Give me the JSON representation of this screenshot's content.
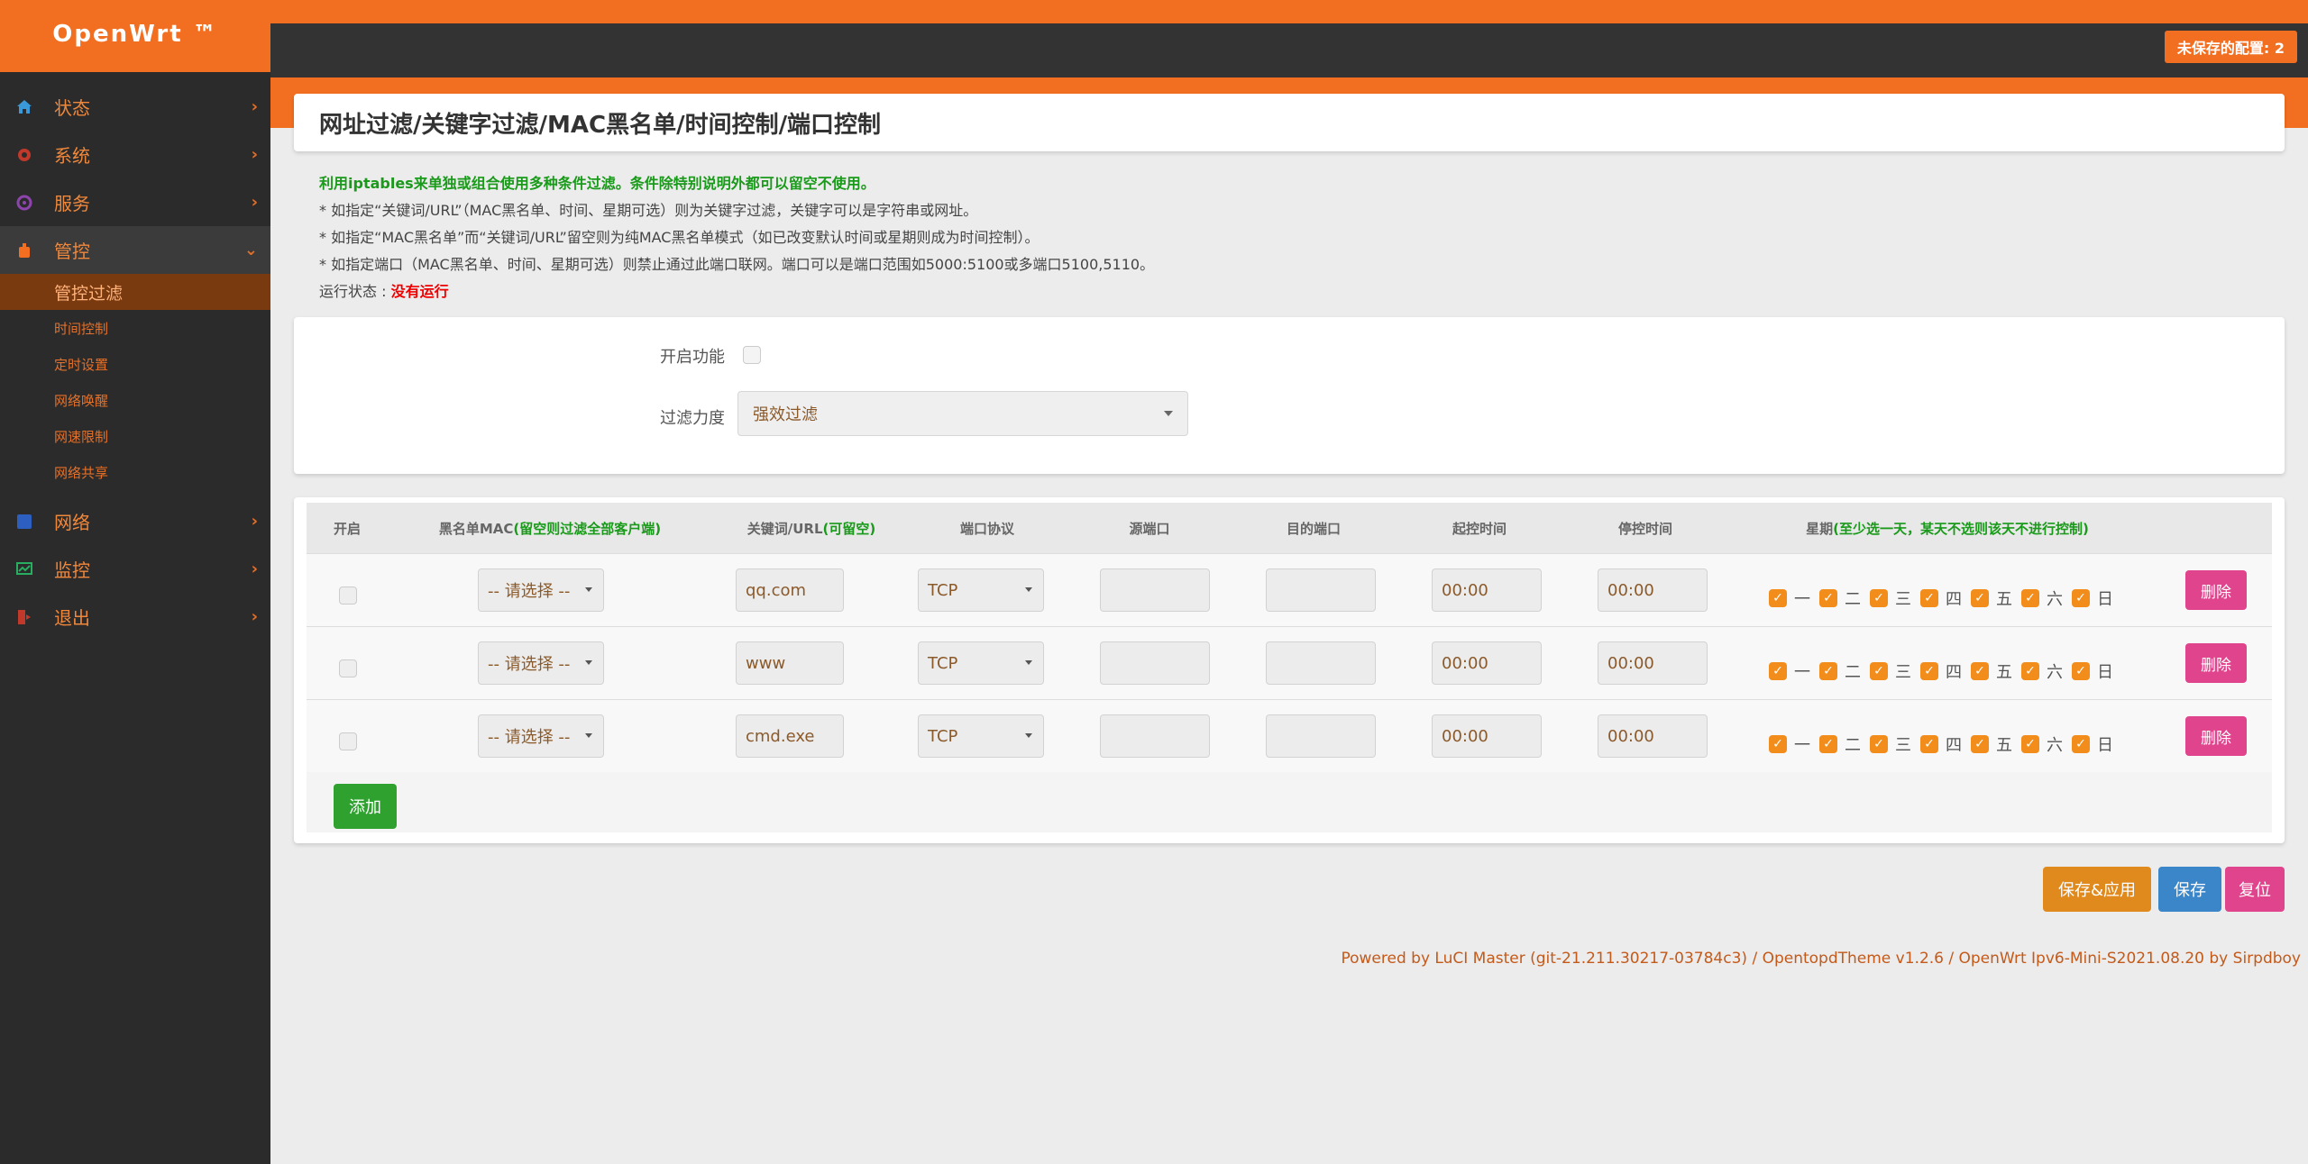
{
  "brand": "OpenWrt ™",
  "unsaved_badge": "未保存的配置: 2",
  "sidebar": {
    "items": [
      {
        "label": "状态",
        "icon": "home-icon",
        "color": "#3a9ad9"
      },
      {
        "label": "系统",
        "icon": "gear-icon",
        "color": "#c0392b"
      },
      {
        "label": "服务",
        "icon": "services-icon",
        "color": "#8e44ad"
      },
      {
        "label": "管控",
        "icon": "control-icon",
        "color": "#f26f21"
      },
      {
        "label": "网络",
        "icon": "network-icon",
        "color": "#2c5fbf"
      },
      {
        "label": "监控",
        "icon": "monitor-icon",
        "color": "#27ae60"
      },
      {
        "label": "退出",
        "icon": "logout-icon",
        "color": "#c0392b"
      }
    ],
    "submenu": [
      "管控过滤",
      "时间控制",
      "定时设置",
      "网络唤醒",
      "网速限制",
      "网络共享"
    ]
  },
  "page_title": "网址过滤/关键字过滤/MAC黑名单/时间控制/端口控制",
  "description": {
    "green": "利用iptables来单独或组合使用多种条件过滤。条件除特别说明外都可以留空不使用。",
    "lines": [
      "* 如指定“关键词/URL”（MAC黑名单、时间、星期可选）则为关键字过滤，关键字可以是字符串或网址。",
      "* 如指定“MAC黑名单”而“关键词/URL”留空则为纯MAC黑名单模式（如已改变默认时间或星期则成为时间控制）。",
      "* 如指定端口（MAC黑名单、时间、星期可选）则禁止通过此端口联网。端口可以是端口范围如5000:5100或多端口5100,5110。"
    ]
  },
  "status": {
    "label": "运行状态 : ",
    "value": "没有运行"
  },
  "settings": {
    "enable_label": "开启功能",
    "strength_label": "过滤力度",
    "strength_value": "强效过滤"
  },
  "table": {
    "headers": {
      "enable": "开启",
      "mac_prefix": "黑名单MAC",
      "mac_hint": "(留空则过滤全部客户端)",
      "keyword_prefix": "关键词/URL",
      "keyword_hint": "(可留空)",
      "protocol": "端口协议",
      "src_port": "源端口",
      "dst_port": "目的端口",
      "start_time": "起控时间",
      "stop_time": "停控时间",
      "week_prefix": "星期",
      "week_hint": "(至少选一天，某天不选则该天不进行控制)"
    },
    "rows": [
      {
        "mac": "-- 请选择 --",
        "keyword": "qq.com",
        "protocol": "TCP",
        "src": "",
        "dst": "",
        "start": "00:00",
        "stop": "00:00"
      },
      {
        "mac": "-- 请选择 --",
        "keyword": "www",
        "protocol": "TCP",
        "src": "",
        "dst": "",
        "start": "00:00",
        "stop": "00:00"
      },
      {
        "mac": "-- 请选择 --",
        "keyword": "cmd.exe",
        "protocol": "TCP",
        "src": "",
        "dst": "",
        "start": "00:00",
        "stop": "00:00"
      }
    ],
    "days": [
      "一",
      "二",
      "三",
      "四",
      "五",
      "六",
      "日"
    ],
    "delete_label": "删除",
    "add_label": "添加"
  },
  "actions": {
    "save_apply": "保存&应用",
    "save": "保存",
    "reset": "复位"
  },
  "footer": "Powered by LuCI Master (git-21.211.30217-03784c3) / OpentopdTheme v1.2.6 / OpenWrt Ipv6-Mini-S2021.08.20 by Sirpdboy"
}
